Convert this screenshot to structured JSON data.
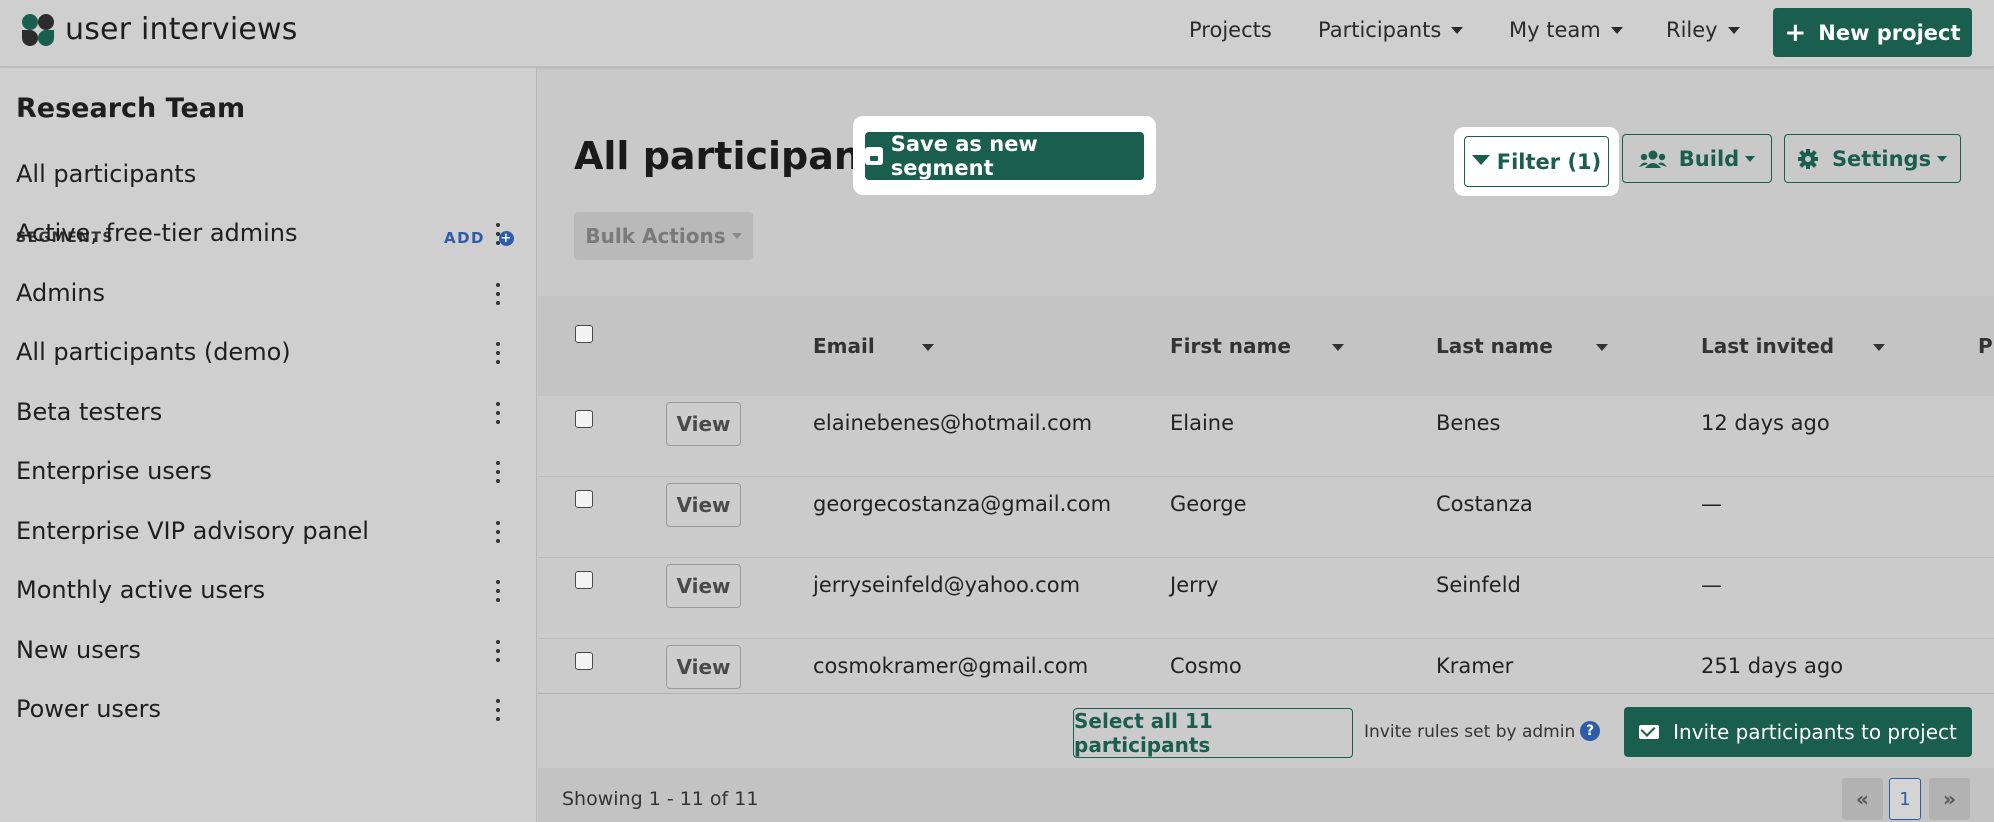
{
  "header": {
    "brand": "user interviews",
    "nav": [
      {
        "label": "Projects",
        "dropdown": false
      },
      {
        "label": "Participants",
        "dropdown": true
      },
      {
        "label": "My team",
        "dropdown": true
      },
      {
        "label": "Riley",
        "dropdown": true
      }
    ],
    "new_project_label": "New project"
  },
  "sidebar": {
    "team": "Research Team",
    "all_participants": "All participants",
    "segments_heading": "SEGMENTS",
    "add_label": "ADD",
    "segments": [
      "Active, free-tier admins",
      "Admins",
      "All participants (demo)",
      "Beta testers",
      "Enterprise users",
      "Enterprise VIP advisory panel",
      "Monthly active users",
      "New users",
      "Power users"
    ]
  },
  "main": {
    "title": "All participants",
    "save_segment_label": "Save as new segment",
    "filter_label": "Filter (1)",
    "build_label": "Build",
    "settings_label": "Settings",
    "bulk_actions_label": "Bulk Actions",
    "columns": [
      "Email",
      "First name",
      "Last name",
      "Last invited",
      "Pl"
    ],
    "view_label": "View",
    "rows": [
      {
        "email": "elainebenes@hotmail.com",
        "first": "Elaine",
        "last": "Benes",
        "invited": "12 days ago"
      },
      {
        "email": "georgecostanza@gmail.com",
        "first": "George",
        "last": "Costanza",
        "invited": "—"
      },
      {
        "email": "jerryseinfeld@yahoo.com",
        "first": "Jerry",
        "last": "Seinfeld",
        "invited": "—"
      },
      {
        "email": "cosmokramer@gmail.com",
        "first": "Cosmo",
        "last": "Kramer",
        "invited": "251 days ago"
      }
    ],
    "select_all_label": "Select all 11 participants",
    "invite_rules": "Invite rules set by admin",
    "invite_label": "Invite participants to project",
    "showing": "Showing 1 - 11 of 11",
    "pager": {
      "prev": "«",
      "current": "1",
      "next": "»"
    }
  },
  "colors": {
    "brand": "#1a5e4d",
    "link": "#2d5ca8"
  }
}
